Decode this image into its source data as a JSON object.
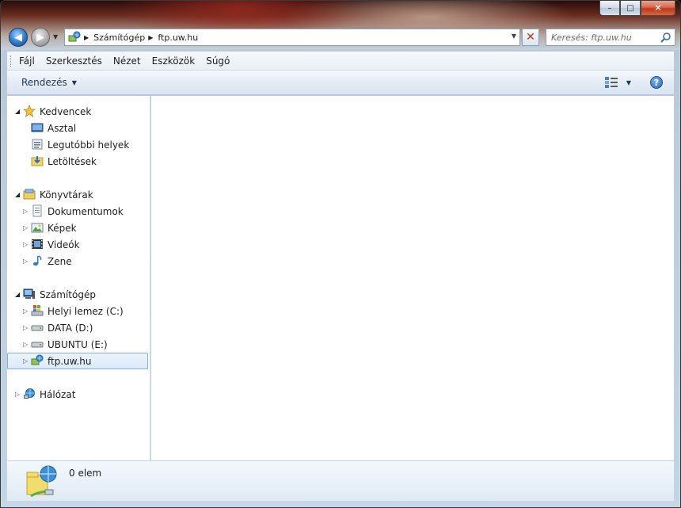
{
  "window": {
    "caption_buttons": {
      "minimize": "–",
      "maximize": "□",
      "close": "✕"
    }
  },
  "address_bar": {
    "breadcrumbs": [
      "Számítógép",
      "ftp.uw.hu"
    ],
    "search_placeholder": "Keresés: ftp.uw.hu"
  },
  "menu": {
    "items": [
      "Fájl",
      "Szerkesztés",
      "Nézet",
      "Eszközök",
      "Súgó"
    ]
  },
  "command_bar": {
    "organize_label": "Rendezés",
    "help_label": "?"
  },
  "nav_pane": {
    "favorites": {
      "label": "Kedvencek",
      "items": [
        "Asztal",
        "Legutóbbi helyek",
        "Letöltések"
      ]
    },
    "libraries": {
      "label": "Könyvtárak",
      "items": [
        "Dokumentumok",
        "Képek",
        "Videók",
        "Zene"
      ]
    },
    "computer": {
      "label": "Számítógép",
      "items": [
        "Helyi lemez (C:)",
        "DATA (D:)",
        "UBUNTU (E:)",
        "ftp.uw.hu"
      ],
      "selected": "ftp.uw.hu"
    },
    "network": {
      "label": "Hálózat"
    }
  },
  "details_pane": {
    "item_count": "0 elem"
  },
  "icons": {
    "back": "back-arrow-icon",
    "forward": "forward-arrow-icon",
    "location": "network-location-icon",
    "stop": "close-icon",
    "search": "search-icon",
    "help": "help-icon"
  }
}
